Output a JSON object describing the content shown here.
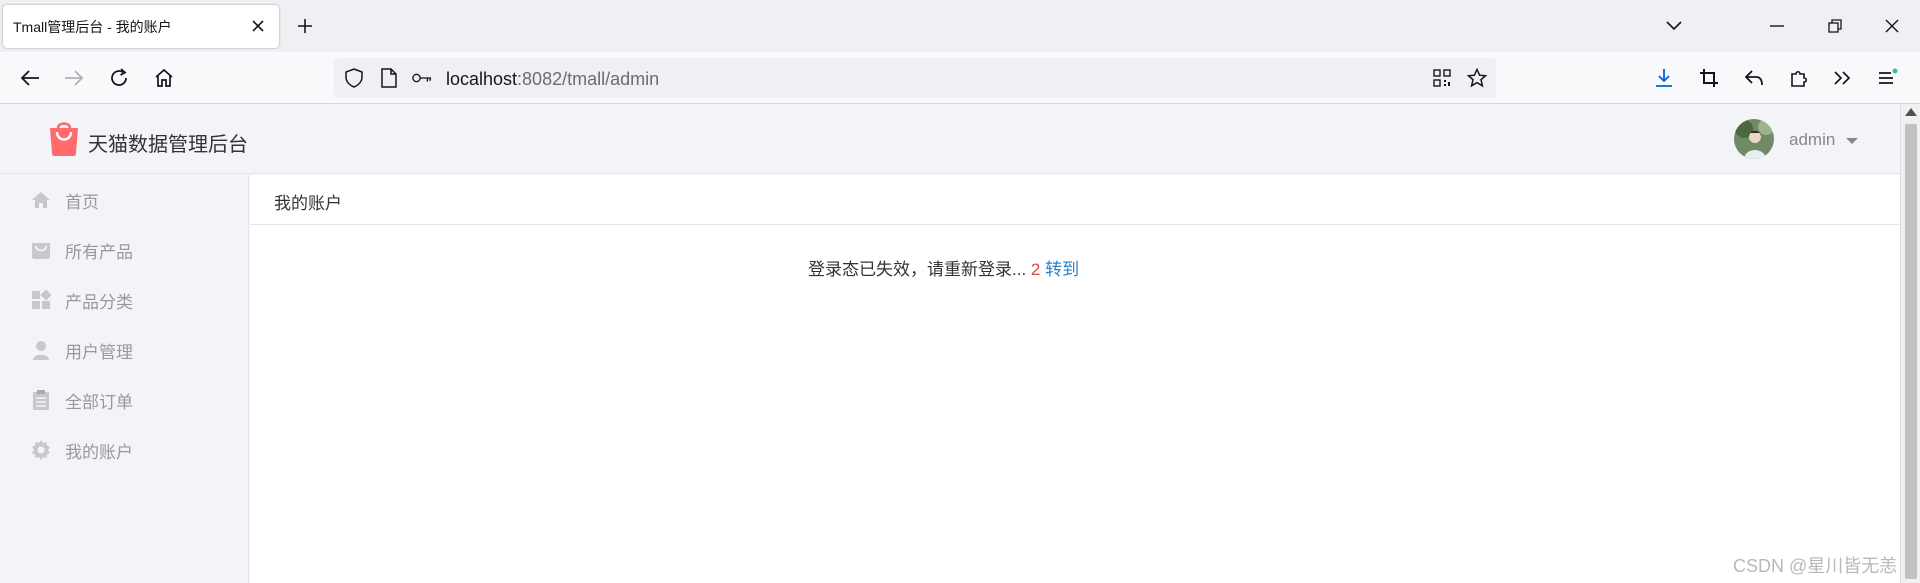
{
  "browser": {
    "tab_title": "Tmall管理后台 - 我的账户",
    "url_host": "localhost",
    "url_path": ":8082/tmall/admin"
  },
  "header": {
    "brand": "天猫数据管理后台",
    "user_name": "admin",
    "logo_color": "#ff6a6a"
  },
  "sidebar": {
    "items": [
      {
        "label": "首页",
        "icon": "home-icon"
      },
      {
        "label": "所有产品",
        "icon": "bag-icon"
      },
      {
        "label": "产品分类",
        "icon": "grid-icon"
      },
      {
        "label": "用户管理",
        "icon": "user-icon"
      },
      {
        "label": "全部订单",
        "icon": "clipboard-icon"
      },
      {
        "label": "我的账户",
        "icon": "gear-icon"
      }
    ]
  },
  "main": {
    "breadcrumb": "我的账户",
    "message": "登录态已失效，请重新登录...",
    "countdown": "2",
    "goto_link": "转到"
  },
  "watermark": "CSDN @星川皆无恙",
  "colors": {
    "accent_link": "#2f7fc7",
    "countdown": "#e0454f",
    "download_icon": "#0061e0"
  }
}
